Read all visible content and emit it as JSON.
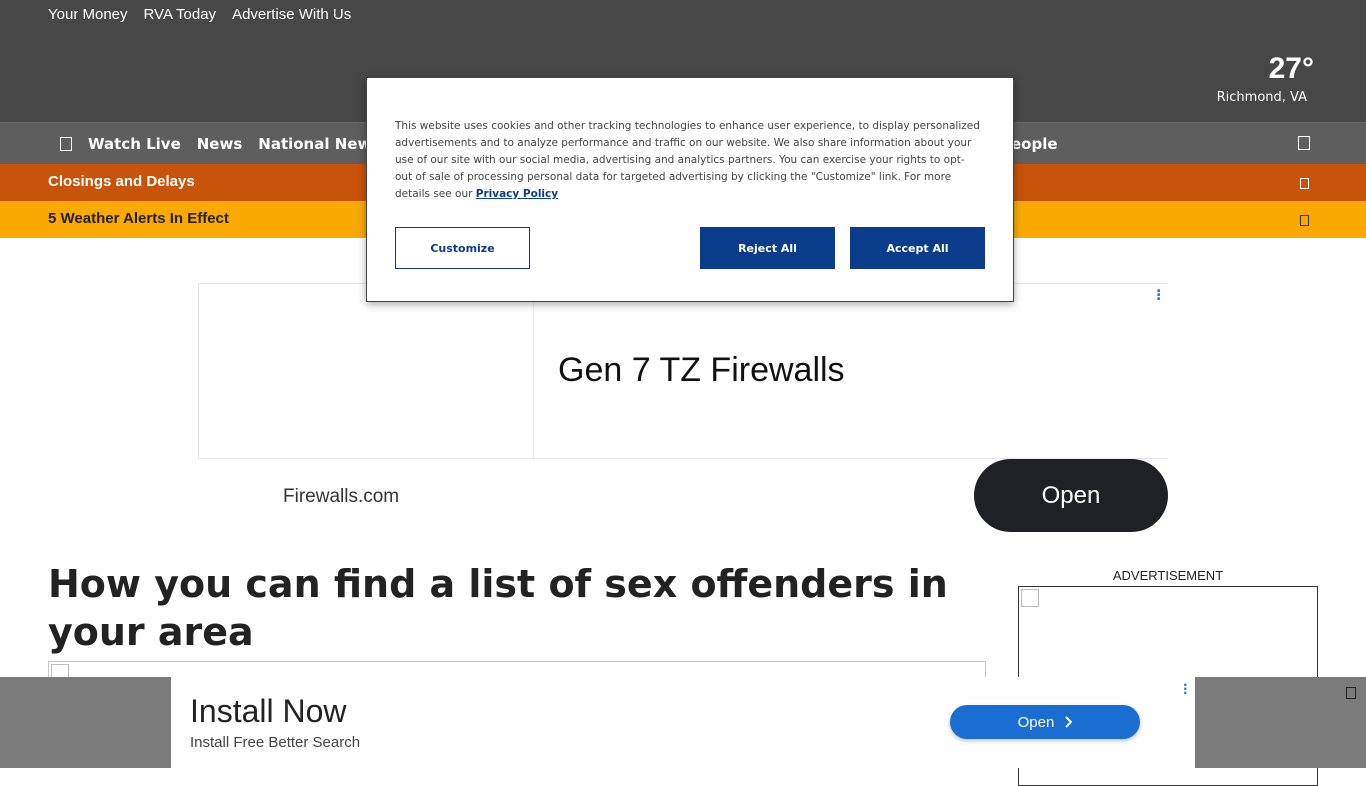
{
  "header": {
    "top_links": [
      "Your Money",
      "RVA Today",
      "Advertise With Us"
    ],
    "weather": {
      "temp": "27°",
      "location": "Richmond, VA"
    }
  },
  "nav": {
    "items": [
      "Watch Live",
      "News",
      "National News"
    ],
    "partial_item": "People"
  },
  "closings": {
    "label": "Closings and Delays"
  },
  "alerts": {
    "label": "5 Weather Alerts In Effect"
  },
  "ad_top": {
    "headline": "Gen 7 TZ Firewalls",
    "domain": "Firewalls.com",
    "cta": "Open"
  },
  "article": {
    "title": "How you can find a list of sex offenders in your area"
  },
  "sidebar": {
    "ad_label": "ADVERTISEMENT"
  },
  "bottom_ad": {
    "headline": "Install Now",
    "subtext": "Install Free Better Search",
    "cta": "Open"
  },
  "consent": {
    "text": "This website uses cookies and other tracking technologies to enhance user experience, to display personalized advertisements and to analyze performance and traffic on our website. We also share information about your use of our site with our social media, advertising and analytics partners. You can exercise your rights to opt-out of sale of processing personal data for targeted advertising by clicking the \"Customize\" link. For more details see our ",
    "policy_link": "Privacy Policy",
    "customize": "Customize",
    "reject": "Reject All",
    "accept": "Accept All"
  },
  "colors": {
    "header_bg": "#474747",
    "nav_bg": "#5e5e5e",
    "closings_bg": "#c8530a",
    "alerts_bg": "#f9a902",
    "consent_primary": "#0b3c8c"
  }
}
